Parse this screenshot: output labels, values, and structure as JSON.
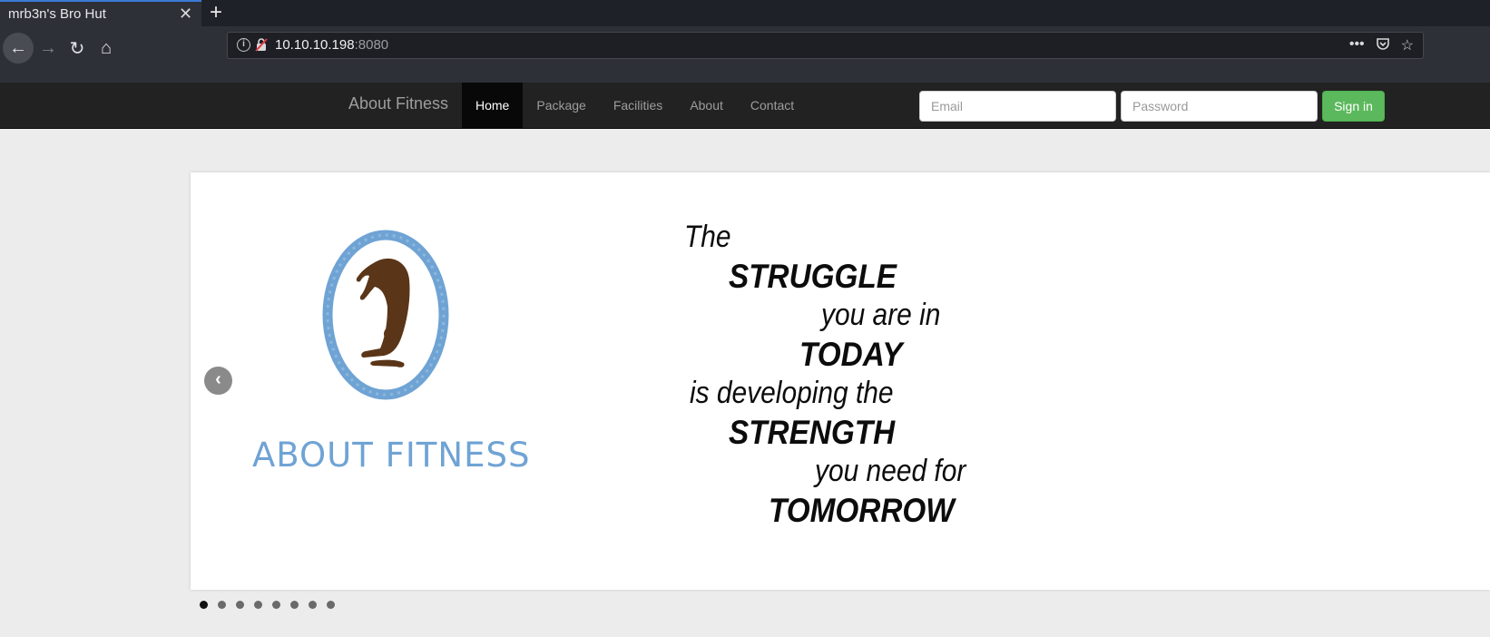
{
  "browser": {
    "tab_title": "mrb3n's Bro Hut",
    "url_host": "10.10.10.198",
    "url_port": ":8080"
  },
  "site": {
    "brand": "About Fitness",
    "menu": [
      "Home",
      "Package",
      "Facilities",
      "About",
      "Contact"
    ],
    "active_menu": "Home",
    "email_placeholder": "Email",
    "password_placeholder": "Password",
    "signin_label": "Sign in"
  },
  "carousel": {
    "logo_text": "ABOUT FITNESS",
    "quote_lines": [
      "The",
      "STRUGGLE",
      "you are in",
      "TODAY",
      "is developing the",
      "STRENGTH",
      "you need for",
      "TOMORROW"
    ],
    "slide_count": 8,
    "active_slide": 1
  },
  "colors": {
    "logo_blue": "#6fa3d4",
    "figure_brown": "#5a3518",
    "signin_green": "#5cb85c"
  }
}
